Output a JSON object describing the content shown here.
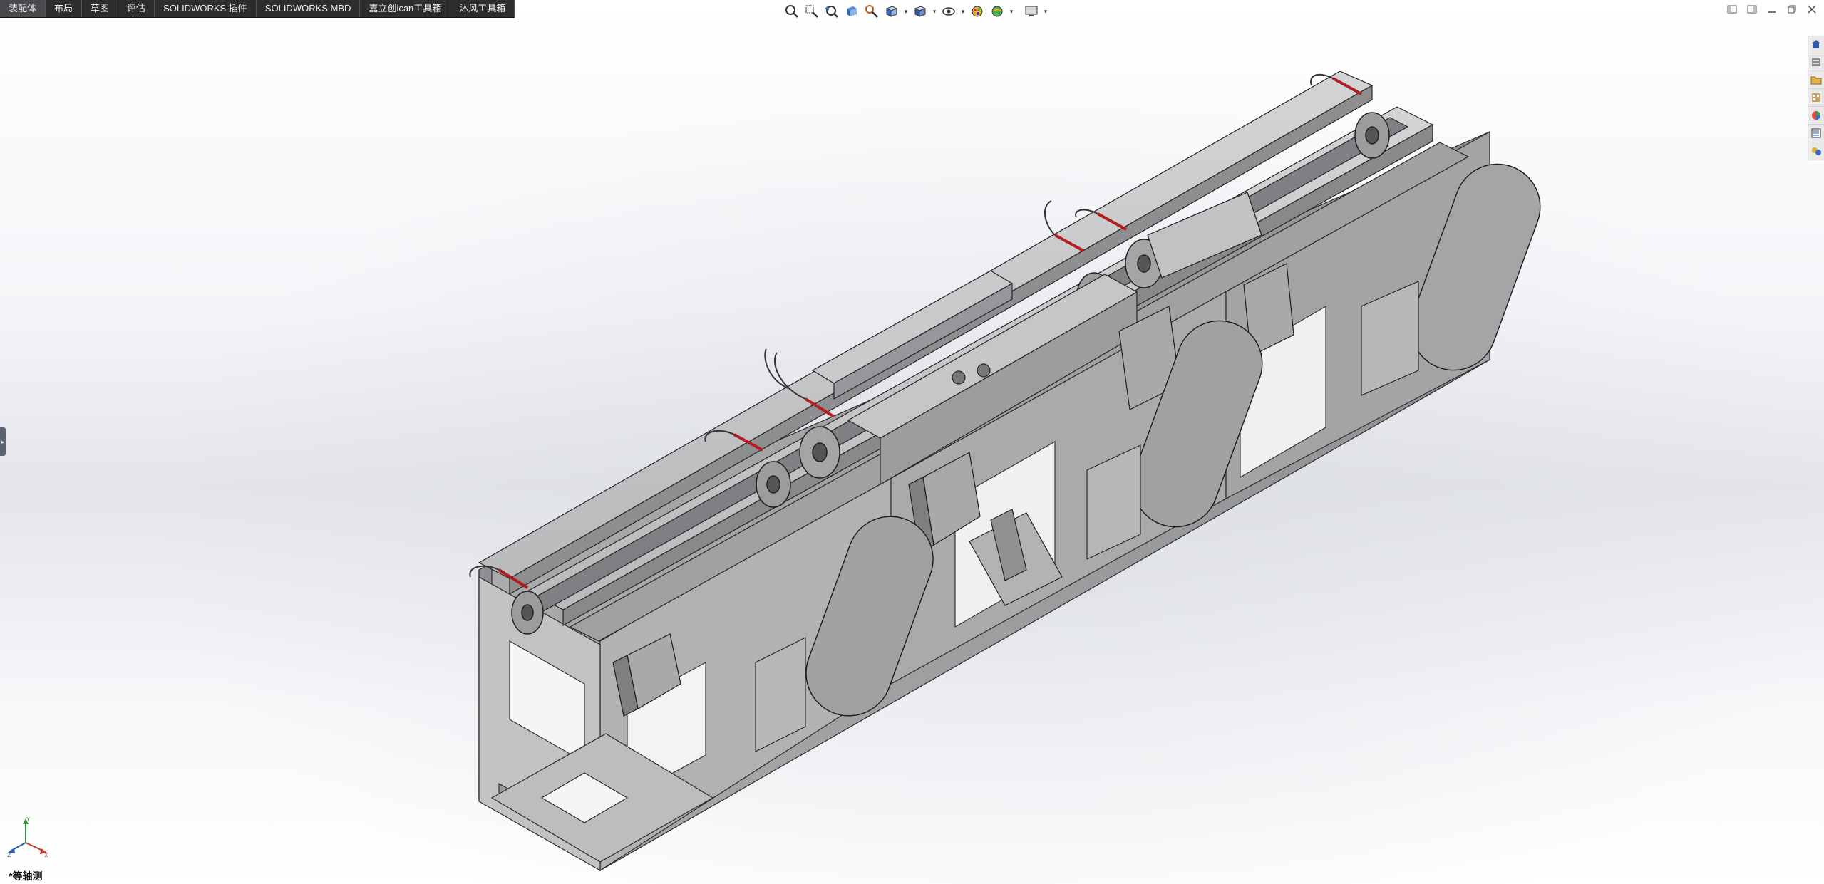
{
  "command_manager": {
    "tabs": [
      {
        "label": "装配体",
        "active": true
      },
      {
        "label": "布局",
        "active": false
      },
      {
        "label": "草图",
        "active": false
      },
      {
        "label": "评估",
        "active": false
      },
      {
        "label": "SOLIDWORKS 插件",
        "active": false
      },
      {
        "label": "SOLIDWORKS MBD",
        "active": false
      },
      {
        "label": "嘉立创ican工具箱",
        "active": false
      },
      {
        "label": "沐风工具箱",
        "active": false
      }
    ]
  },
  "heads_up_toolbar": {
    "icons": [
      "zoom-to-fit-icon",
      "zoom-to-area-icon",
      "previous-view-icon",
      "section-view-icon",
      "dynamic-annotation-icon",
      "view-orientation-icon",
      "display-style-icon",
      "hide-show-items-icon",
      "edit-appearance-icon",
      "apply-scene-icon",
      "view-settings-icon"
    ]
  },
  "task_pane": {
    "icons": [
      "solidworks-resources-icon",
      "design-library-icon",
      "file-explorer-icon",
      "view-palette-icon",
      "appearances-icon",
      "custom-properties-icon",
      "solidworks-forum-icon"
    ]
  },
  "viewport": {
    "view_orientation": "*等轴测",
    "accent_colors": {
      "part_gray": "#b4b6b8",
      "part_dark": "#6e7073",
      "sensor_red": "#b41e1e"
    }
  }
}
